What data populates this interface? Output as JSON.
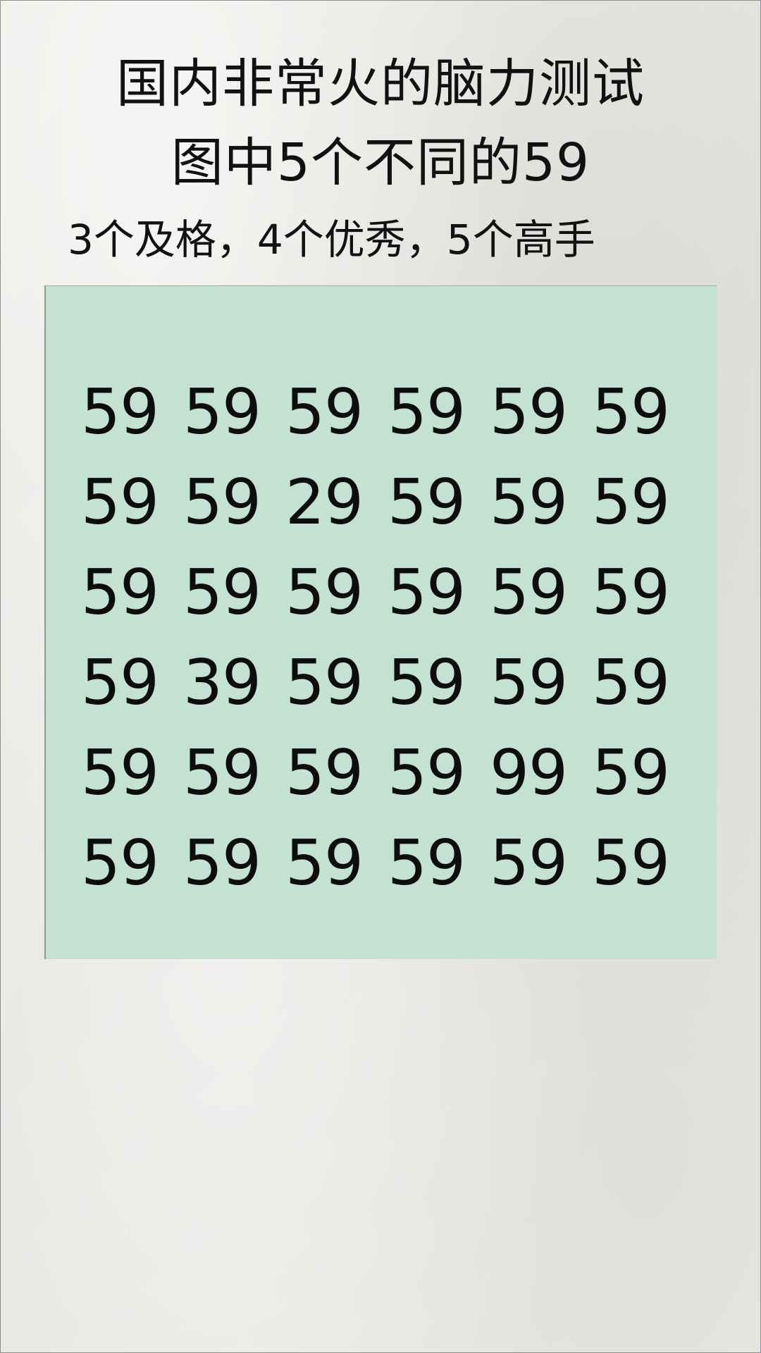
{
  "header": {
    "title_line1": "国内非常火的脑力测试",
    "title_line2": "图中5个不同的59",
    "subtitle": "3个及格，4个优秀，5个高手"
  },
  "puzzle": {
    "panel_color": "#c3e2d3",
    "rows": [
      [
        "59",
        "59",
        "59",
        "59",
        "59",
        "59"
      ],
      [
        "59",
        "59",
        "29",
        "59",
        "59",
        "59"
      ],
      [
        "59",
        "59",
        "59",
        "59",
        "59",
        "59"
      ],
      [
        "59",
        "39",
        "59",
        "59",
        "59",
        "59"
      ],
      [
        "59",
        "59",
        "59",
        "59",
        "99",
        "59"
      ],
      [
        "59",
        "59",
        "59",
        "59",
        "59",
        "59"
      ]
    ]
  }
}
